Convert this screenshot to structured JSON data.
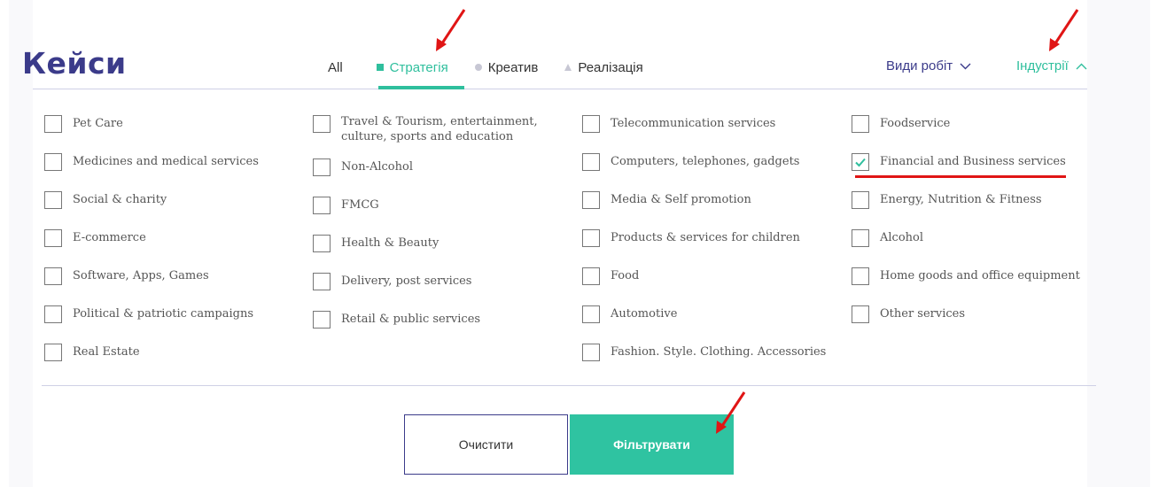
{
  "header": {
    "title": "Кейси",
    "tabs": [
      {
        "label": "All"
      },
      {
        "label": "Стратегія"
      },
      {
        "label": "Креатив"
      },
      {
        "label": "Реалізація"
      }
    ],
    "active_tab": "Стратегія",
    "dropdowns": {
      "work_types": "Види робіт",
      "industries": "Індустрії"
    }
  },
  "industries": {
    "col1": [
      {
        "label": "Pet Care",
        "checked": false
      },
      {
        "label": "Medicines and medical services",
        "checked": false
      },
      {
        "label": "Social & charity",
        "checked": false
      },
      {
        "label": "E-commerce",
        "checked": false
      },
      {
        "label": "Software, Apps, Games",
        "checked": false
      },
      {
        "label": "Political & patriotic campaigns",
        "checked": false
      },
      {
        "label": "Real Estate",
        "checked": false
      }
    ],
    "col2": [
      {
        "label": "Travel & Tourism, entertainment, culture, sports and education",
        "checked": false
      },
      {
        "label": "Non-Alcohol",
        "checked": false
      },
      {
        "label": "FMCG",
        "checked": false
      },
      {
        "label": "Health & Beauty",
        "checked": false
      },
      {
        "label": "Delivery, post services",
        "checked": false
      },
      {
        "label": "Retail & public services",
        "checked": false
      }
    ],
    "col3": [
      {
        "label": "Telecommunication services",
        "checked": false
      },
      {
        "label": "Computers, telephones, gadgets",
        "checked": false
      },
      {
        "label": "Media & Self promotion",
        "checked": false
      },
      {
        "label": "Products & services for children",
        "checked": false
      },
      {
        "label": "Food",
        "checked": false
      },
      {
        "label": "Automotive",
        "checked": false
      },
      {
        "label": "Fashion. Style. Clothing. Accessories",
        "checked": false
      }
    ],
    "col4": [
      {
        "label": "Foodservice",
        "checked": false
      },
      {
        "label": "Financial and Business services",
        "checked": true
      },
      {
        "label": "Energy, Nutrition & Fitness",
        "checked": false
      },
      {
        "label": "Alcohol",
        "checked": false
      },
      {
        "label": "Home goods and office equipment",
        "checked": false
      },
      {
        "label": "Other services",
        "checked": false
      }
    ]
  },
  "buttons": {
    "clear": "Очистити",
    "filter": "Фільтрувати"
  },
  "colors": {
    "accent": "#2fbf9d",
    "brand": "#3b3b8a",
    "annotation": "#e01515"
  }
}
